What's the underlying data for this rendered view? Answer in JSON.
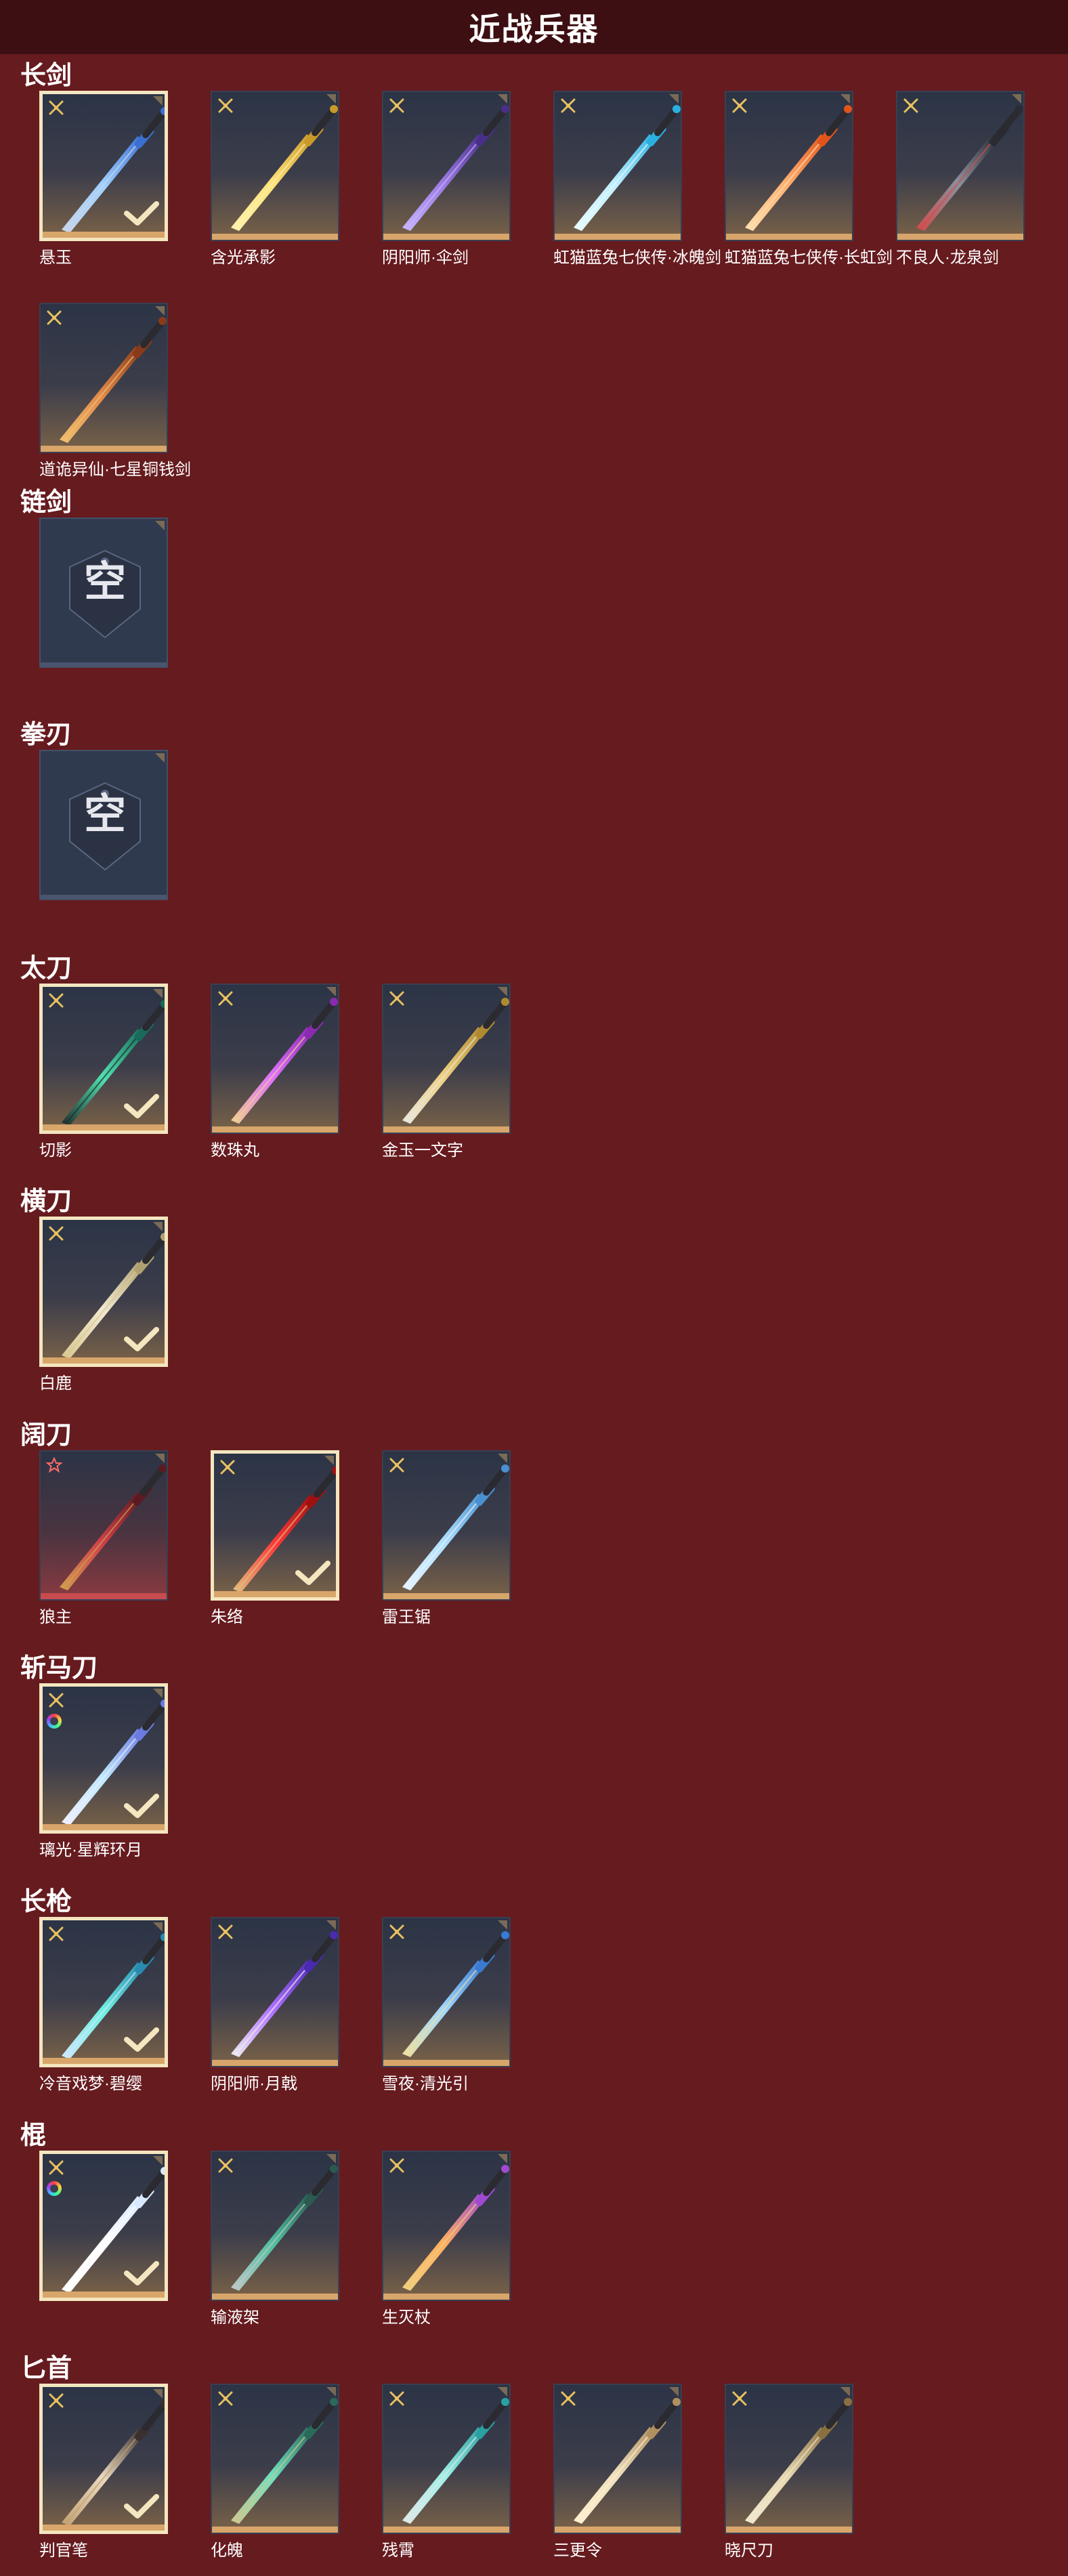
{
  "page": {
    "title": "近战兵器",
    "background": "#661b1f"
  },
  "sections": [
    {
      "title": "长剑",
      "items": [
        {
          "name": "悬玉",
          "selected": true,
          "badge": "gold",
          "art": "sword-blue"
        },
        {
          "name": "含光承影",
          "selected": false,
          "badge": "gold",
          "art": "sword-gold"
        },
        {
          "name": "阴阳师·伞剑",
          "selected": false,
          "badge": "gold",
          "art": "umbrella"
        },
        {
          "name": "虹猫蓝兔七侠传·冰魄剑",
          "selected": false,
          "badge": "gold",
          "art": "sword-ice"
        },
        {
          "name": "虹猫蓝兔七侠传·长虹剑",
          "selected": false,
          "badge": "gold",
          "art": "sword-fire"
        },
        {
          "name": "不良人·龙泉剑",
          "selected": false,
          "badge": "gold",
          "art": "sword-dark"
        },
        {
          "name": "道诡异仙·七星铜钱剑",
          "selected": false,
          "badge": "gold",
          "art": "sword-coin"
        }
      ]
    },
    {
      "title": "链剑",
      "items": [
        {
          "name": "",
          "empty": true,
          "empty_text": "空"
        }
      ]
    },
    {
      "title": "拳刃",
      "items": [
        {
          "name": "",
          "empty": true,
          "empty_text": "空"
        }
      ]
    },
    {
      "title": "太刀",
      "items": [
        {
          "name": "切影",
          "selected": true,
          "badge": "gold",
          "art": "katana-green"
        },
        {
          "name": "数珠丸",
          "selected": false,
          "badge": "gold",
          "art": "katana-purple"
        },
        {
          "name": "金玉一文字",
          "selected": false,
          "badge": "gold",
          "art": "katana-gold"
        }
      ]
    },
    {
      "title": "横刀",
      "items": [
        {
          "name": "白鹿",
          "selected": true,
          "badge": "gold",
          "art": "hengdao"
        }
      ]
    },
    {
      "title": "阔刀",
      "items": [
        {
          "name": "狼主",
          "selected": false,
          "badge": "red",
          "art": "broad-red",
          "tier": "red"
        },
        {
          "name": "朱络",
          "selected": true,
          "badge": "gold",
          "art": "broad-crimson"
        },
        {
          "name": "雷王锯",
          "selected": false,
          "badge": "gold",
          "art": "broad-thunder"
        }
      ]
    },
    {
      "title": "斩马刀",
      "items": [
        {
          "name": "璃光·星辉环月",
          "selected": true,
          "badge": "gold",
          "rainbow": true,
          "art": "moon-blade"
        }
      ]
    },
    {
      "title": "长枪",
      "items": [
        {
          "name": "冷音戏梦·碧缨",
          "selected": true,
          "badge": "gold",
          "art": "spear-cyan"
        },
        {
          "name": "阴阳师·月戟",
          "selected": false,
          "badge": "gold",
          "art": "spear-purple"
        },
        {
          "name": "雪夜·清光引",
          "selected": false,
          "badge": "gold",
          "art": "spear-ice"
        }
      ]
    },
    {
      "title": "棍",
      "items": [
        {
          "name": "",
          "selected": true,
          "badge": "gold",
          "rainbow": true,
          "art": "staff-light"
        },
        {
          "name": "输液架",
          "selected": false,
          "badge": "gold",
          "art": "iv-stand"
        },
        {
          "name": "生灭杖",
          "selected": false,
          "badge": "gold",
          "art": "staff-fire"
        }
      ]
    },
    {
      "title": "匕首",
      "items": [
        {
          "name": "判官笔",
          "selected": true,
          "badge": "gold",
          "art": "dagger-brush"
        },
        {
          "name": "化魄",
          "selected": false,
          "badge": "gold",
          "art": "dagger-green"
        },
        {
          "name": "残霄",
          "selected": false,
          "badge": "gold",
          "art": "dagger-curve"
        },
        {
          "name": "三更令",
          "selected": false,
          "badge": "gold",
          "art": "dagger-ornate"
        },
        {
          "name": "晓尺刀",
          "selected": false,
          "badge": "gold",
          "art": "dagger-jagged"
        }
      ]
    }
  ]
}
